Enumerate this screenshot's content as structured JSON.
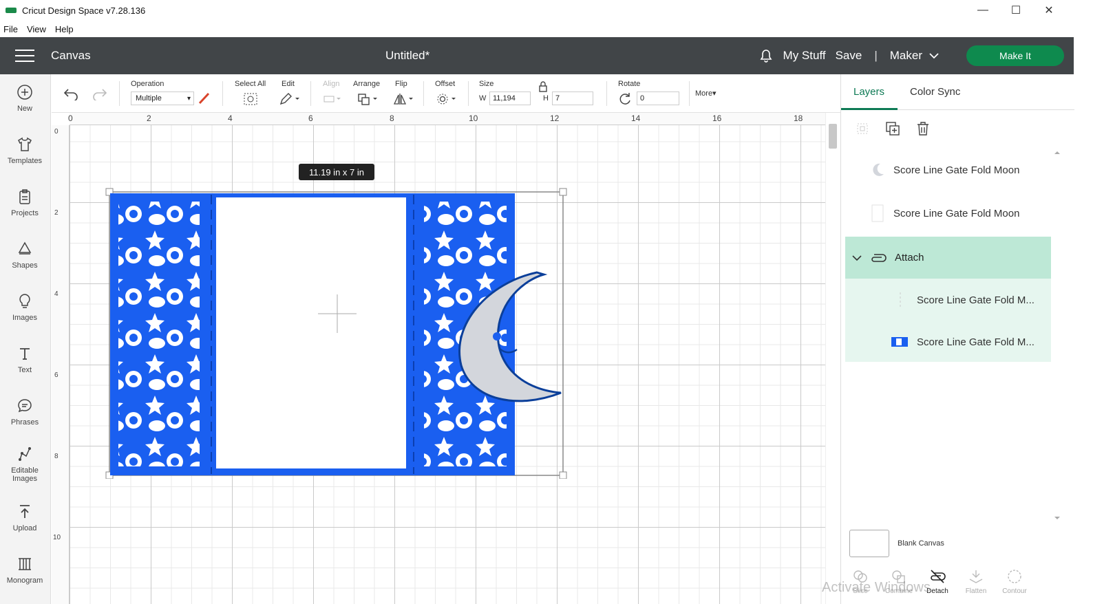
{
  "window": {
    "title": "Cricut Design Space  v7.28.136",
    "controls": [
      "—",
      "☐",
      "✕"
    ]
  },
  "menu": [
    "File",
    "View",
    "Help"
  ],
  "topbar": {
    "section": "Canvas",
    "document_title": "Untitled*",
    "my_stuff": "My Stuff",
    "save": "Save",
    "separator": "|",
    "machine": "Maker",
    "make_it": "Make It",
    "accent_color": "#0e8a4e"
  },
  "leftbar": [
    {
      "label": "New",
      "icon": "plus-circle-icon"
    },
    {
      "label": "Templates",
      "icon": "shirt-icon"
    },
    {
      "label": "Projects",
      "icon": "clipboard-icon"
    },
    {
      "label": "Shapes",
      "icon": "shapes-icon"
    },
    {
      "label": "Images",
      "icon": "bulb-icon"
    },
    {
      "label": "Text",
      "icon": "text-icon"
    },
    {
      "label": "Phrases",
      "icon": "speech-bubble-icon"
    },
    {
      "label": "Editable Images",
      "icon": "editable-image-icon"
    },
    {
      "label": "Upload",
      "icon": "upload-icon"
    },
    {
      "label": "Monogram",
      "icon": "monogram-icon"
    }
  ],
  "toolbar": {
    "operation_label": "Operation",
    "operation_value": "Multiple",
    "select_all": "Select All",
    "edit": "Edit",
    "align": "Align",
    "arrange": "Arrange",
    "flip": "Flip",
    "offset": "Offset",
    "size": "Size",
    "w_label": "W",
    "w_value": "11,194",
    "h_label": "H",
    "h_value": "7",
    "rotate": "Rotate",
    "rotate_value": "0",
    "more": "More▾"
  },
  "ruler": {
    "top": [
      "0",
      "2",
      "4",
      "6",
      "8",
      "10",
      "12",
      "14",
      "16",
      "18"
    ],
    "left": [
      "0",
      "2",
      "4",
      "6",
      "8",
      "10"
    ]
  },
  "canvas": {
    "dimension_tooltip": "11.19  in x 7  in",
    "design_color": "#1a5ff0",
    "moon_color": "#d3d6dc"
  },
  "panel": {
    "tabs": [
      "Layers",
      "Color Sync"
    ],
    "layers": [
      {
        "name": "Score Line Gate Fold Moon",
        "thumb": "moon-thumbnail-icon"
      },
      {
        "name": "Score Line Gate Fold Moon",
        "thumb": "blank-thumbnail-icon"
      }
    ],
    "group": {
      "name": "Attach",
      "children": [
        {
          "name": "Score Line Gate Fold M...",
          "thumb": "score-line-thumbnail-icon"
        },
        {
          "name": "Score Line Gate Fold M...",
          "thumb": "blue-card-thumbnail-icon"
        }
      ]
    },
    "blank_canvas": "Blank Canvas",
    "bottom_tools": [
      {
        "label": "Slice",
        "enabled": false
      },
      {
        "label": "Combine",
        "enabled": false
      },
      {
        "label": "Detach",
        "enabled": true
      },
      {
        "label": "Flatten",
        "enabled": false
      },
      {
        "label": "Contour",
        "enabled": false
      }
    ]
  },
  "watermark": "Activate Windows"
}
